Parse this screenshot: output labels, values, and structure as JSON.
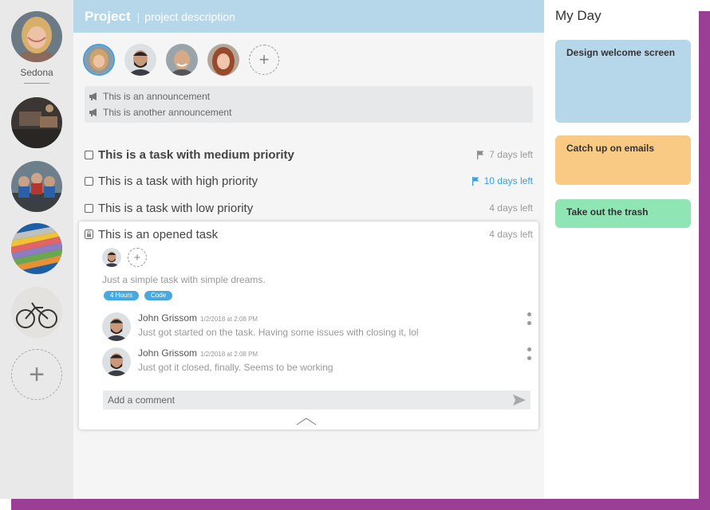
{
  "rail": {
    "user_name": "Sedona",
    "projects": [
      "workspace",
      "cyclists",
      "color-swatches",
      "bicycle"
    ]
  },
  "header": {
    "title": "Project",
    "description": "project description"
  },
  "members": [
    "woman-blonde",
    "man-bearded",
    "man-smiling",
    "woman-redhead"
  ],
  "announcements": [
    "This is an announcement",
    "This is another announcement"
  ],
  "tasks": [
    {
      "title": "This is a task with medium priority",
      "due": "7 days left",
      "flag": "gray"
    },
    {
      "title": "This is a task with high priority",
      "due": "10 days left",
      "flag": "blue"
    },
    {
      "title": "This is a task with low priority",
      "due": "4 days left",
      "flag": "none"
    }
  ],
  "opened_task": {
    "title": "This is an opened task",
    "due": "4 days left",
    "description": "Just a simple task with simple dreams.",
    "tags": [
      "4 Hours",
      "Code"
    ],
    "comments": [
      {
        "author": "John Grissom",
        "time": "1/2/2018 at 2:08 PM",
        "text": "Just got started on the task. Having some issues with closing it, lol"
      },
      {
        "author": "John Grissom",
        "time": "1/2/2018 at 2:08 PM",
        "text": "Just got it closed, finally. Seems to be working"
      }
    ],
    "comment_placeholder": "Add a comment"
  },
  "my_day": {
    "title": "My Day",
    "cards": [
      "Design welcome screen",
      "Catch up on emails",
      "Take out the trash"
    ]
  },
  "colors": {
    "accent": "#3a9fdd",
    "header": "#b6d7e9",
    "frame": "#9b3f96",
    "card_blue": "#b6d7e9",
    "card_orange": "#f9ca83",
    "card_green": "#8fe5b4"
  }
}
